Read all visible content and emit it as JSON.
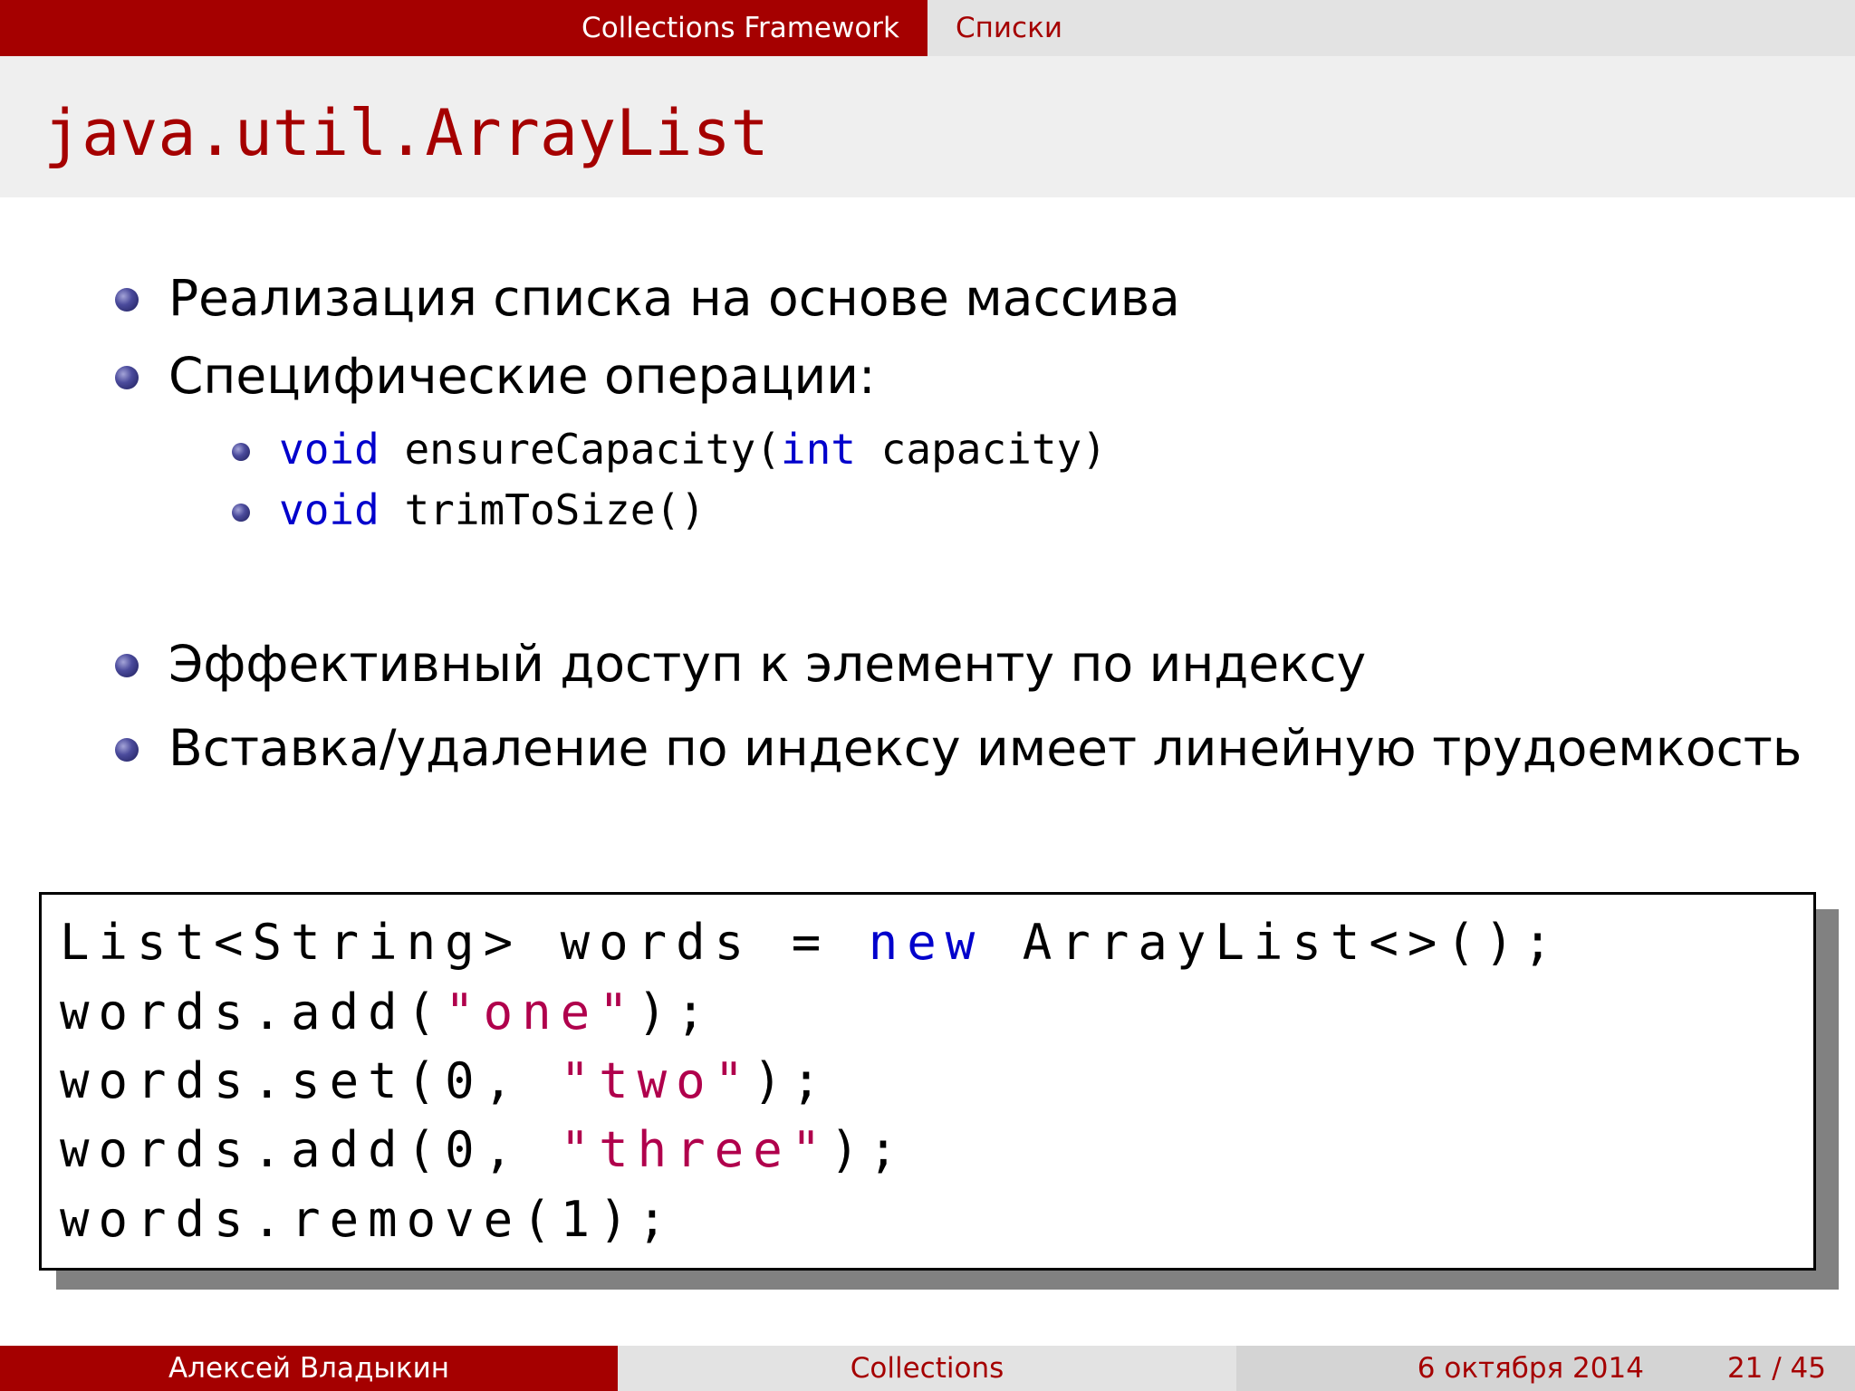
{
  "header": {
    "section": "Collections Framework",
    "subsection": "Списки"
  },
  "slide": {
    "title": "java.util.ArrayList",
    "bullets": [
      "Реализация списка на основе массива",
      "Специфические операции:",
      "Эффективный доступ к элементу по индексу",
      "Вставка/удаление по индексу имеет линейную трудоемкость"
    ],
    "operations": [
      {
        "keyword": "void",
        "signature_pre": " ensureCapacity(",
        "param_type": "int",
        "signature_post": " capacity)"
      },
      {
        "keyword": "void",
        "signature_pre": " trimToSize()",
        "param_type": "",
        "signature_post": ""
      }
    ]
  },
  "code": {
    "lines": [
      [
        {
          "t": "List<String> words = ",
          "c": "plain"
        },
        {
          "t": "new",
          "c": "kw"
        },
        {
          "t": " ArrayList<>();",
          "c": "plain"
        }
      ],
      [
        {
          "t": "words.add(",
          "c": "plain"
        },
        {
          "t": "\"one\"",
          "c": "str"
        },
        {
          "t": ");",
          "c": "plain"
        }
      ],
      [
        {
          "t": "words.set(0, ",
          "c": "plain"
        },
        {
          "t": "\"two\"",
          "c": "str"
        },
        {
          "t": ");",
          "c": "plain"
        }
      ],
      [
        {
          "t": "words.add(0, ",
          "c": "plain"
        },
        {
          "t": "\"three\"",
          "c": "str"
        },
        {
          "t": ");",
          "c": "plain"
        }
      ],
      [
        {
          "t": "words.remove(1);",
          "c": "plain"
        }
      ]
    ]
  },
  "footer": {
    "author": "Алексей Владыкин",
    "short_title": "Collections",
    "date": "6 октября 2014",
    "page": "21 / 45"
  },
  "colors": {
    "theme_red": "#a50000",
    "keyword_blue": "#0000cc",
    "string_magenta": "#b0004c"
  }
}
